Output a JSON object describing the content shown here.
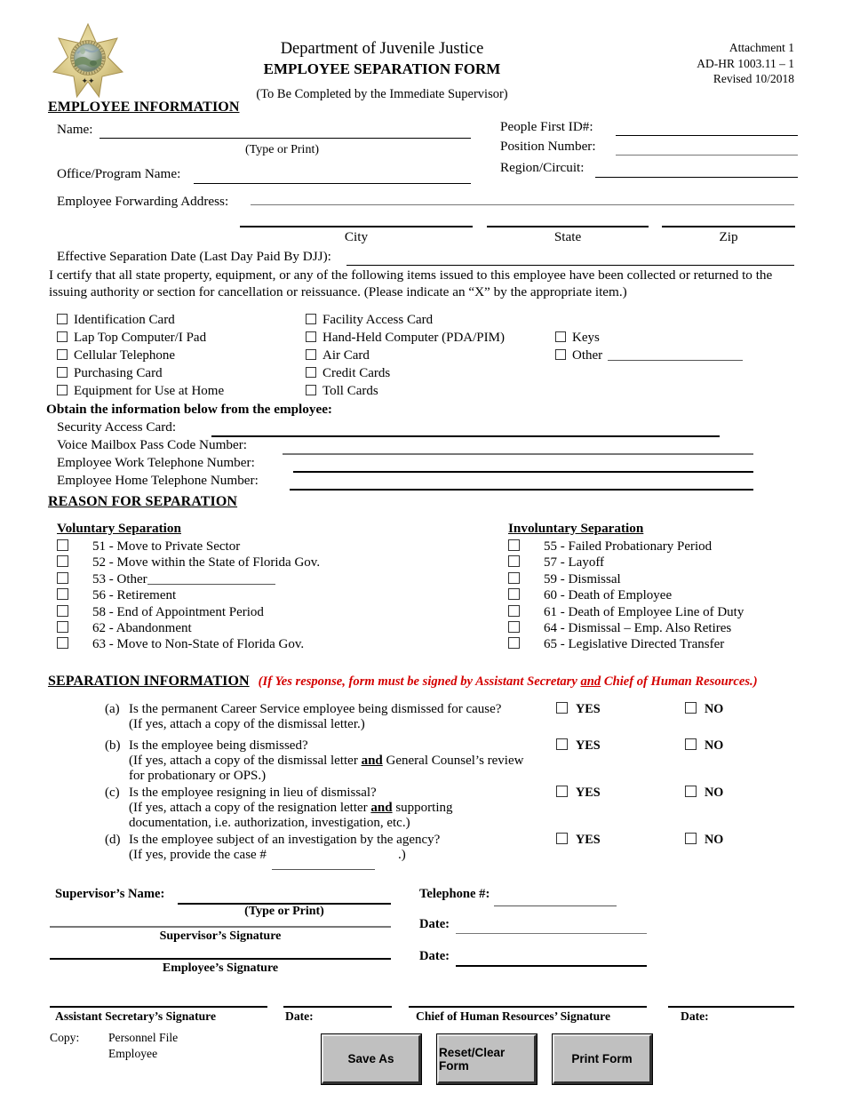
{
  "header": {
    "logo_icon": "djj-star-badge-seal-icon",
    "title_line1": "Department of Juvenile Justice",
    "title_line2": "EMPLOYEE SEPARATION FORM",
    "title_line3": "(To Be Completed by the Immediate Supervisor)",
    "attachment": "Attachment 1",
    "form_number": "AD-HR 1003.11 – 1",
    "revised": "Revised 10/2018"
  },
  "employee_information": {
    "heading": "EMPLOYEE INFORMATION",
    "name_label": "Name:",
    "name_value": "",
    "type_or_print": "(Type or Print)",
    "office_program_label": "Office/Program Name:",
    "office_program_value": "",
    "forwarding_address_label": "Employee Forwarding Address:",
    "forwarding_address_value": "",
    "address_line2_value": "",
    "city_label": "City",
    "city_value": "",
    "state_label": "State",
    "state_value": "",
    "zip_label": "Zip",
    "zip_value": "",
    "people_first_label": "People First ID#:",
    "people_first_value": "",
    "position_number_label": "Position Number:",
    "position_number_value": "",
    "region_circuit_label": "Region/Circuit:",
    "region_circuit_value": "",
    "effective_date_label": "Effective Separation Date (Last Day Paid By DJJ):",
    "effective_date_value": ""
  },
  "property": {
    "certify_text": "I certify that all state property, equipment, or any of the following items issued to this employee have been collected or returned to the issuing authority or section for cancellation or reissuance. (Please indicate an “X” by the appropriate item.)",
    "column1": [
      "Identification Card",
      "Lap Top Computer/I Pad",
      "Cellular Telephone",
      "Purchasing Card",
      "Equipment for Use at Home"
    ],
    "column2": [
      "Facility Access Card",
      "Hand-Held Computer (PDA/PIM)",
      "Air Card",
      "Credit Cards",
      "Toll Cards"
    ],
    "column3": [
      "Keys",
      "Other"
    ],
    "other_value": ""
  },
  "obtain": {
    "heading": "Obtain the information below from the employee:",
    "rows": [
      {
        "label": "Security Access Card:",
        "value": ""
      },
      {
        "label": "Voice Mailbox Pass Code Number:",
        "value": ""
      },
      {
        "label": "Employee Work Telephone Number:",
        "value": ""
      },
      {
        "label": "Employee Home Telephone Number:",
        "value": ""
      }
    ]
  },
  "reason": {
    "heading": "REASON FOR SEPARATION",
    "voluntary_heading": "Voluntary Separation",
    "voluntary_items": [
      "51 - Move to Private Sector",
      "52 - Move within the State of Florida Gov.",
      "53 - Other",
      "56 - Retirement",
      "58 - End of Appointment Period",
      "62 - Abandonment",
      "63 - Move to Non-State of Florida Gov."
    ],
    "voluntary_other_value": "",
    "involuntary_heading": "Involuntary Separation",
    "involuntary_items": [
      "55 - Failed Probationary Period",
      "57 - Layoff",
      "59 - Dismissal",
      "60 - Death of Employee",
      "61 - Death of Employee Line of Duty",
      "64 - Dismissal – Emp. Also Retires",
      "65 - Legislative Directed Transfer"
    ]
  },
  "separation_information": {
    "heading": "SEPARATION INFORMATION",
    "heading_note": "(If Yes response, form must be signed by Assistant Secretary and Chief of Human Resources.)",
    "yes_label": "YES",
    "no_label": "NO",
    "questions": [
      {
        "letter": "(a)",
        "text": "Is the permanent Career Service employee being dismissed for cause?",
        "note": "(If yes, attach a copy of the dismissal letter.)"
      },
      {
        "letter": "(b)",
        "text": "Is the employee being dismissed?",
        "note": "(If yes, attach a copy of the dismissal letter and General Counsel’s review",
        "note2": "for probationary or OPS.)"
      },
      {
        "letter": "(c)",
        "text": "Is the employee resigning in lieu of dismissal?",
        "note": "(If yes, attach a copy of the resignation letter and supporting",
        "note2": "documentation, i.e. authorization, investigation, etc.)"
      },
      {
        "letter": "(d)",
        "text": "Is the employee subject of an investigation by the agency?",
        "note": "(If yes, provide the case #",
        "note_tail": ".)",
        "case_value": ""
      }
    ]
  },
  "signatures": {
    "supervisor_name_label": "Supervisor’s Name:",
    "supervisor_name_value": "",
    "type_or_print": "(Type or Print)",
    "telephone_label": "Telephone #:",
    "telephone_value": "",
    "supervisor_signature_caption": "Supervisor’s Signature",
    "employee_signature_caption": "Employee’s Signature",
    "date_label_1": "Date:",
    "date_value_1": "",
    "date_label_2": "Date:",
    "date_value_2": ""
  },
  "footer": {
    "assistant_secretary_caption": "Assistant Secretary’s Signature",
    "assistant_date_label": "Date:",
    "assistant_date_value": "",
    "chief_hr_caption": "Chief of Human Resources’ Signature",
    "chief_date_label": "Date:",
    "chief_date_value": "",
    "copy_label": "Copy:",
    "copy_items": [
      "Personnel File",
      "Employee"
    ],
    "buttons": [
      {
        "label": "Save As"
      },
      {
        "label": "Reset/Clear Form"
      },
      {
        "label": "Print Form"
      }
    ]
  },
  "colors": {
    "red_note": "#d40000",
    "badge_gold": "#d8c98a",
    "button_face": "#c0c0c0"
  }
}
